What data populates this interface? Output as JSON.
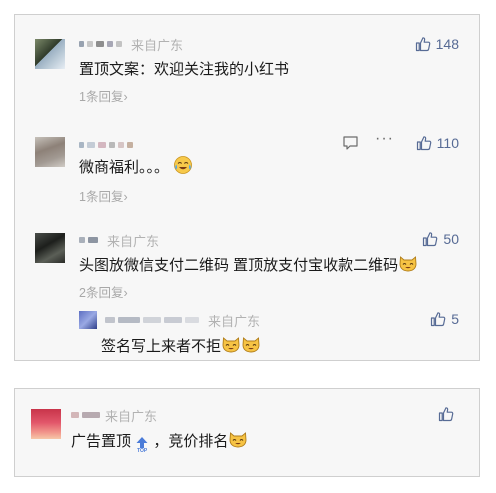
{
  "comments": [
    {
      "from": "来自广东",
      "text": "置顶文案：欢迎关注我的小红书",
      "likes": "148",
      "replies": "1条回复"
    },
    {
      "from": "",
      "text": "微商福利。。。",
      "likes": "110",
      "replies": "1条回复"
    },
    {
      "from": "来自广东",
      "text": "头图放微信支付二维码 置顶放支付宝收款二维码",
      "likes": "50",
      "replies": "2条回复",
      "reply": {
        "from": "来自广东",
        "text": "签名写上来者不拒",
        "likes": "5"
      }
    }
  ],
  "ad_comment": {
    "from": "来自广东",
    "text_before": "广告置顶",
    "text_after": "，竞价排名",
    "top_badge": "TOP"
  },
  "colors": {
    "accent": "#576b95",
    "meta": "#a8a8a8",
    "panel_bg": "#f7f7f7"
  },
  "icons": [
    "thumbs-up-icon",
    "comment-icon",
    "more-icon",
    "smile-cat-emoji",
    "crying-emoji",
    "top-arrow-icon"
  ]
}
